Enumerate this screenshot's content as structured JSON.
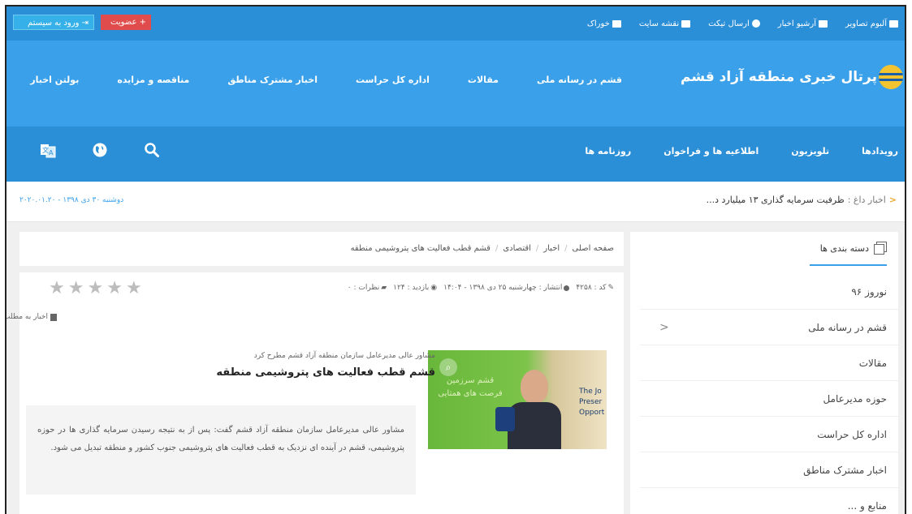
{
  "topbar": {
    "login_label": "ورود به سیستم",
    "join_label": "عضویت",
    "links": [
      {
        "label": "آلبوم تصاویر",
        "icon": "gallery-icon"
      },
      {
        "label": "آرشیو اخبار",
        "icon": "archive-icon"
      },
      {
        "label": "ارسال تیکت",
        "icon": "plus-circle-icon"
      },
      {
        "label": "نقشه سایت",
        "icon": "sitemap-icon"
      },
      {
        "label": "خوراک",
        "icon": "rss-icon"
      }
    ]
  },
  "header": {
    "site_title": "پرتال خبری منطقه آزاد قشم",
    "nav": [
      "قشم در رسانه ملی",
      "مقالات",
      "اداره کل حراست",
      "اخبار مشترک مناطق",
      "مناقصه و مزایده",
      "بولتن اخبار"
    ]
  },
  "subnav": {
    "links": [
      "رویدادها",
      "تلویزیون",
      "اطلاعیه ها و فراخوان",
      "روزنامه ها"
    ],
    "icons": [
      "search-icon",
      "globe-icon",
      "translate-icon"
    ]
  },
  "ticker": {
    "label": "اخبار داغ :",
    "headline": "ظرفیت سرمایه گذاری ۱۳ میلیارد د...",
    "date": "دوشنبه ۳۰ دی ۱۳۹۸ - ۲۰۲۰.۰۱.۲۰"
  },
  "sidebar": {
    "tab_label": "دسته بندی ها",
    "items": [
      "نوروز ۹۶",
      "قشم در رسانه ملی",
      "مقالات",
      "حوزه مدیرعامل",
      "اداره کل حراست",
      "اخبار مشترک مناطق",
      "منابع و ..."
    ]
  },
  "breadcrumb": [
    "صفحه اصلی",
    "اخبار",
    "اقتصادی",
    "قشم قطب فعالیت های پتروشیمی منطقه"
  ],
  "article": {
    "code": "کد : ۴۲۵۸",
    "published": "انتشار : چهارشنبه ۲۵ دی ۱۳۹۸ - ۱۴:۰۴",
    "visits": "بازدید : ۱۲۴",
    "comments": "نظرات : ۰",
    "share": "اخبار به مطلب : ۰ نفر",
    "kicker": "مشاور عالی مدیرعامل سازمان منطقه آزاد قشم مطرح کرد",
    "title": "قشم قطب فعالیت های پتروشیمی منطقه",
    "lead": "مشاور عالی مدیرعامل سازمان منطقه آزاد قشم گفت: پس از به نتیجه رسیدن سرمایه گذاری ها در حوزه پتروشیمی، قشم در آینده ای نزدیک به قطب فعالیت های پتروشیمی جنوب کشور و منطقه تبدیل می شود.",
    "rating": 0,
    "stars_total": 5,
    "image_text": "قشم سرزمین فرصت های همتایی",
    "image_side_text": "The Jo Preser Opport"
  },
  "colors": {
    "topbar": "#2b8fd8",
    "header": "#3aa0ea",
    "accent": "#e04b4b"
  }
}
